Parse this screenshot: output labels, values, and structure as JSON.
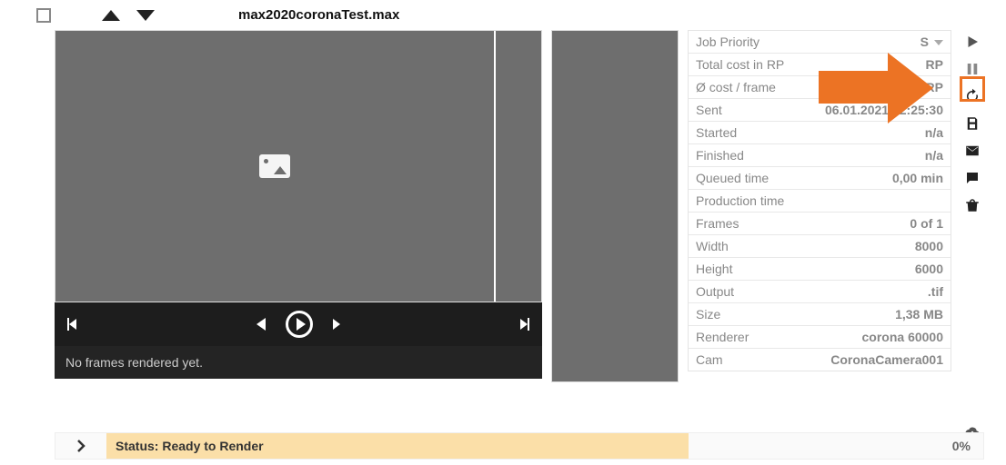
{
  "header": {
    "filename": "max2020coronaTest.max"
  },
  "preview": {
    "no_frames": "No frames rendered yet."
  },
  "info": {
    "rows": [
      {
        "label": "Job Priority",
        "value": "S",
        "dropdown": true
      },
      {
        "label": "Total cost in RP",
        "value": "RP"
      },
      {
        "label": "Ø cost / frame",
        "value": "0,00 RP"
      },
      {
        "label": "Sent",
        "value": "06.01.2021 12:25:30"
      },
      {
        "label": "Started",
        "value": "n/a"
      },
      {
        "label": "Finished",
        "value": "n/a"
      },
      {
        "label": "Queued time",
        "value": "0,00 min"
      },
      {
        "label": "Production time",
        "value": ""
      },
      {
        "label": "Frames",
        "value": "0 of 1"
      },
      {
        "label": "Width",
        "value": "8000"
      },
      {
        "label": "Height",
        "value": "6000"
      },
      {
        "label": "Output",
        "value": ".tif"
      },
      {
        "label": "Size",
        "value": "1,38 MB"
      },
      {
        "label": "Renderer",
        "value": "corona 60000"
      },
      {
        "label": "Cam",
        "value": "CoronaCamera001"
      }
    ]
  },
  "status": {
    "text": "Status: Ready to Render",
    "percent": "0%"
  }
}
